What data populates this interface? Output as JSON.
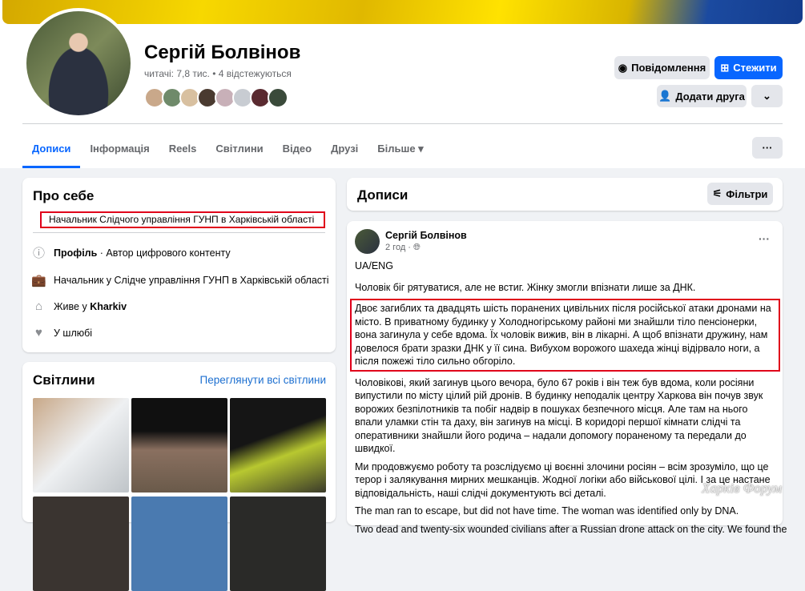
{
  "profile": {
    "name": "Сергій Болвінов",
    "stats": "читачі: 7,8 тис. • 4 відстежуються"
  },
  "buttons": {
    "message": "Повідомлення",
    "follow": "Стежити",
    "add_friend": "Додати друга",
    "more": "⌄",
    "dots": "···"
  },
  "tabs": [
    "Дописи",
    "Інформація",
    "Reels",
    "Світлини",
    "Відео",
    "Друзі",
    "Більше ▾"
  ],
  "about": {
    "title": "Про себе",
    "bio": "Начальник Слідчого управління ГУНП в Харківській області",
    "rows": [
      {
        "bold": "Профіль",
        "text": " · Автор цифрового контенту"
      },
      {
        "text": "Начальник у Слідче управління ГУНП в Харківській області"
      },
      {
        "text": "Живе у ",
        "bold": "Kharkiv"
      },
      {
        "text": "У шлюбі"
      }
    ]
  },
  "photos": {
    "title": "Світлини",
    "see_all": "Переглянути всі світлини"
  },
  "posts_header": {
    "title": "Дописи",
    "filters": "Фільтри"
  },
  "post": {
    "author": "Сергій Болвінов",
    "time": "2 год ·",
    "paragraphs": [
      "UA/ENG",
      "Чоловік біг рятуватися, але не встиг. Жінку змогли впізнати лише за ДНК.",
      "Двоє загиблих та двадцять шість поранених цивільних після російської атаки дронами на місто. В приватному будинку у Холодногірському районі ми знайшли тіло пенсіонерки, вона загинула у себе вдома. Їх чоловік вижив, він в лікарні. А щоб впізнати дружину, нам довелося брати зразки ДНК у її сина. Вибухом ворожого шахеда жінці відірвало ноги, а після пожежі тіло сильно обгоріло.",
      "Чоловікові, який загинув цього вечора, було 67 років і він теж був вдома, коли росіяни випустили по місту цілий рій дронів. В будинку неподалік центру Харкова він почув звук ворожих безпілотників та побіг надвір в пошуках безпечного місця. Але там на нього впали уламки стін та даху, він загинув на місці. В коридорі першої кімнати слідчі та оперативники знайшли його родича – надали допомогу пораненому та передали до швидкої.",
      "Ми продовжуємо роботу та розслідуємо ці воєнні злочини росіян – всім зрозуміло, що це терор і залякування мирних мешканців. Жодної логіки або військової цілі. І за це настане відповідальність, наші слідчі документують всі деталі.",
      "The man ran to escape, but did not have time. The woman was identified only by DNA.",
      "Two dead and twenty-six wounded civilians after a Russian drone attack on the city. We found the"
    ]
  },
  "watermark": "Харків Форум"
}
